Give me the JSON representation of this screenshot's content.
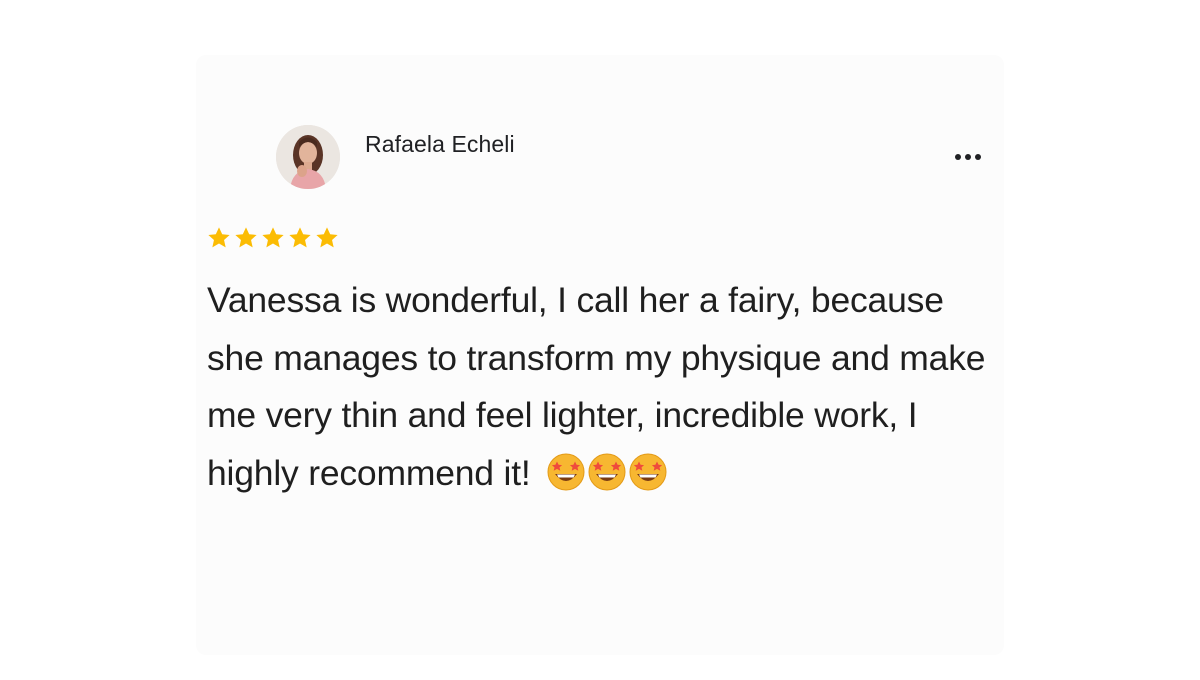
{
  "review": {
    "reviewer_name": "Rafaela Echeli",
    "rating_value": 5,
    "rating_max": 5,
    "text": "Vanessa is wonderful, I call her a fairy, because she manages to transform my physique and make me very thin and feel lighter, incredible work, I highly recommend it!",
    "emojis": [
      "star-struck-emoji",
      "star-struck-emoji",
      "star-struck-emoji"
    ]
  },
  "icons": {
    "more": "more-horizontal-icon",
    "star": "star-icon"
  },
  "colors": {
    "star": "#fbbc04",
    "text": "#1f1f1f",
    "name": "#202124"
  }
}
